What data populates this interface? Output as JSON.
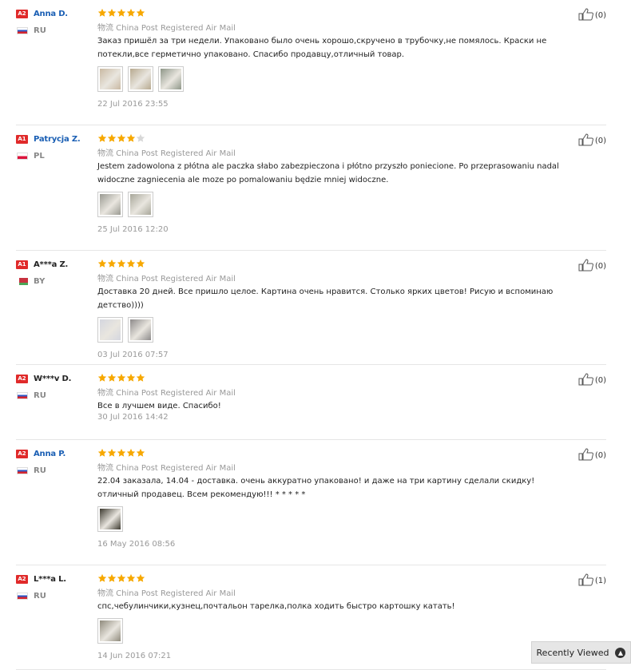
{
  "reviews": [
    {
      "badge": "A2",
      "name": "Anna D.",
      "country": "RU",
      "flag": "ru",
      "rating": 5,
      "shipping": "物流 China Post Registered Air Mail",
      "text": "Заказ пришёл за три недели. Упаковано было очень хорошо,скручено в трубочку,не помялось. Краски не потекли,все герметично упаковано. Спасибо продавцу,отличный товар.",
      "date": "22 Jul 2016 23:55",
      "likes": "(0)",
      "images": [
        "#c9b9a2",
        "#b7a98f",
        "#8e9688"
      ]
    },
    {
      "badge": "A1",
      "name": "Patrycja Z.",
      "country": "PL",
      "flag": "pl",
      "rating": 4,
      "shipping": "物流 China Post Registered Air Mail",
      "text": "Jestem zadowolona z płótna ale paczka słabo zabezpieczona i płótno przyszło poniecione. Po przeprasowaniu nadal widoczne zagniecenia ale moze po pomalowaniu będzie mniej widoczne.",
      "date": "25 Jul 2016 12:20",
      "likes": "(0)",
      "images": [
        "#9a9a92",
        "#a8a79a"
      ]
    },
    {
      "badge": "A1",
      "name": "A***a Z.",
      "country": "BY",
      "flag": "by",
      "rating": 5,
      "shipping": "物流 China Post Registered Air Mail",
      "text": "Доставка 20 дней. Все пришло целое. Картина очень нравится. Столько ярких цветов! Рисую и вспоминаю детство))))",
      "date": "03 Jul 2016 07:57",
      "likes": "(0)",
      "images": [
        "#d4d6df",
        "#8d8a8a"
      ]
    },
    {
      "badge": "A2",
      "name": "W***v D.",
      "country": "RU",
      "flag": "ru",
      "rating": 5,
      "shipping": "物流 China Post Registered Air Mail",
      "text": "Все в лучшем виде. Спасибо!",
      "date": "30 Jul 2016 14:42",
      "likes": "(0)",
      "images": []
    },
    {
      "badge": "A2",
      "name": "Anna P.",
      "country": "RU",
      "flag": "ru",
      "rating": 5,
      "shipping": "物流 China Post Registered Air Mail",
      "text": "22.04 заказала, 14.04 - доставка. очень аккуратно упаковано! и даже на три картину сделали скидку! отличный продавец. Всем рекомендую!!! * * * * *",
      "date": "16 May 2016 08:56",
      "likes": "(0)",
      "images": [
        "#3d3a30"
      ]
    },
    {
      "badge": "A2",
      "name": "L***a L.",
      "country": "RU",
      "flag": "ru",
      "rating": 5,
      "shipping": "物流 China Post Registered Air Mail",
      "text": "спс,чебулинчики,кузнец,почтальон тарелка,полка ходить быстро картошку катать!",
      "date": "14 Jun 2016 07:21",
      "likes": "(1)",
      "images": [
        "#8f8a7c"
      ]
    }
  ],
  "recently_viewed": {
    "label": "Recently Viewed",
    "icon": "chevron-up-circle-icon"
  },
  "colors": {
    "star": "#f7a800",
    "star_empty": "#d8d8d8",
    "badge": "#e02a2a",
    "link": "#1a5fb4"
  }
}
